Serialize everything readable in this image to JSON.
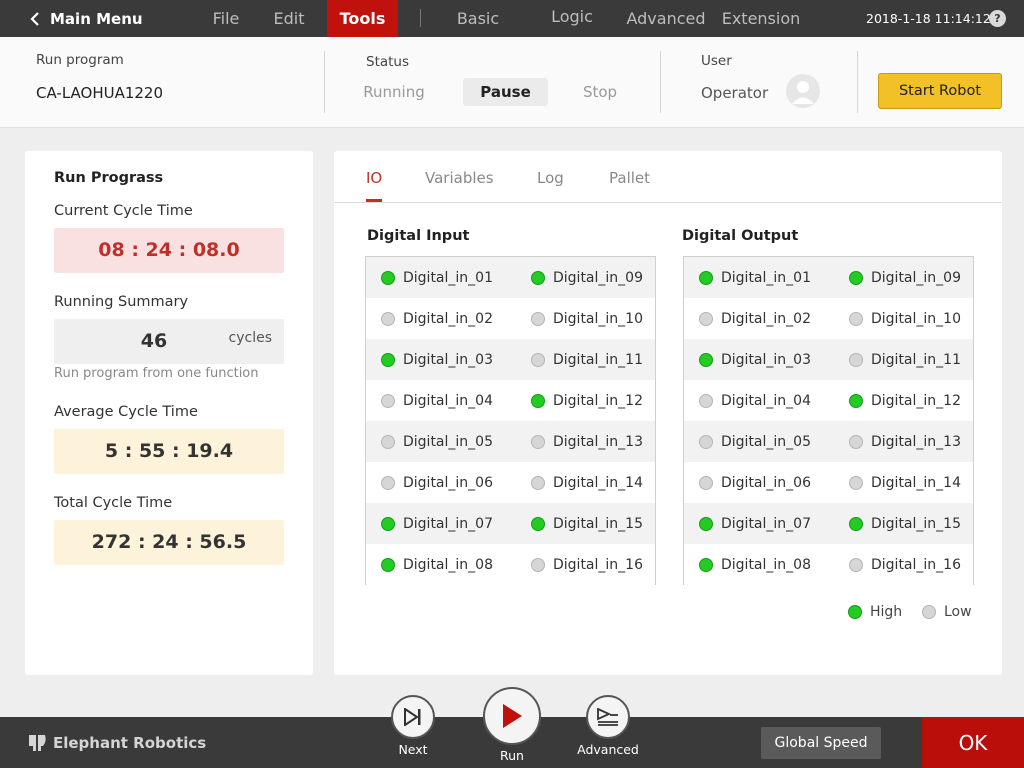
{
  "topbar": {
    "back_label": "Main Menu",
    "menu": [
      {
        "label": "File"
      },
      {
        "label": "Edit"
      },
      {
        "label": "Tools",
        "active": true
      },
      {
        "label": "Basic"
      },
      {
        "label": "Logic"
      },
      {
        "label": "Advanced"
      },
      {
        "label": "Extension"
      }
    ],
    "datetime": "2018-1-18 11:14:12",
    "help_label": "?"
  },
  "header": {
    "run_program_label": "Run program",
    "run_program_value": "CA-LAOHUA1220",
    "status_label": "Status",
    "status_options": [
      "Running",
      "Pause",
      "Stop"
    ],
    "status_active": "Pause",
    "user_label": "User",
    "user_value": "Operator",
    "start_button": "Start Robot"
  },
  "progress": {
    "title": "Run Prograss",
    "current_cycle_label": "Current Cycle Time",
    "current_cycle_value": "08 : 24 : 08.0",
    "running_summary_label": "Running Summary",
    "cycles_count": "46",
    "cycles_unit": "cycles",
    "note": "Run program from one function",
    "average_cycle_label": "Average Cycle Time",
    "average_cycle_value": "5 : 55 : 19.4",
    "total_cycle_label": "Total Cycle Time",
    "total_cycle_value": "272 : 24 : 56.5"
  },
  "tabs": [
    "IO",
    "Variables",
    "Log",
    "Pallet"
  ],
  "active_tab": "IO",
  "io": {
    "input_title": "Digital Input",
    "output_title": "Digital Output",
    "inputs": [
      {
        "name": "Digital_in_01",
        "high": true
      },
      {
        "name": "Digital_in_02",
        "high": false
      },
      {
        "name": "Digital_in_03",
        "high": true
      },
      {
        "name": "Digital_in_04",
        "high": false
      },
      {
        "name": "Digital_in_05",
        "high": false
      },
      {
        "name": "Digital_in_06",
        "high": false
      },
      {
        "name": "Digital_in_07",
        "high": true
      },
      {
        "name": "Digital_in_08",
        "high": true
      },
      {
        "name": "Digital_in_09",
        "high": true
      },
      {
        "name": "Digital_in_10",
        "high": false
      },
      {
        "name": "Digital_in_11",
        "high": false
      },
      {
        "name": "Digital_in_12",
        "high": true
      },
      {
        "name": "Digital_in_13",
        "high": false
      },
      {
        "name": "Digital_in_14",
        "high": false
      },
      {
        "name": "Digital_in_15",
        "high": true
      },
      {
        "name": "Digital_in_16",
        "high": false
      }
    ],
    "outputs": [
      {
        "name": "Digital_in_01",
        "high": true
      },
      {
        "name": "Digital_in_02",
        "high": false
      },
      {
        "name": "Digital_in_03",
        "high": true
      },
      {
        "name": "Digital_in_04",
        "high": false
      },
      {
        "name": "Digital_in_05",
        "high": false
      },
      {
        "name": "Digital_in_06",
        "high": false
      },
      {
        "name": "Digital_in_07",
        "high": true
      },
      {
        "name": "Digital_in_08",
        "high": true
      },
      {
        "name": "Digital_in_09",
        "high": true
      },
      {
        "name": "Digital_in_10",
        "high": false
      },
      {
        "name": "Digital_in_11",
        "high": false
      },
      {
        "name": "Digital_in_12",
        "high": true
      },
      {
        "name": "Digital_in_13",
        "high": false
      },
      {
        "name": "Digital_in_14",
        "high": false
      },
      {
        "name": "Digital_in_15",
        "high": true
      },
      {
        "name": "Digital_in_16",
        "high": false
      }
    ],
    "legend_high": "High",
    "legend_low": "Low"
  },
  "bottombar": {
    "brand": "Elephant Robotics",
    "next_label": "Next",
    "run_label": "Run",
    "advanced_label": "Advanced",
    "global_speed_label": "Global Speed",
    "ok_label": "OK"
  },
  "colors": {
    "accent_red": "#c0110d",
    "led_high": "#22cc22",
    "led_low": "#d6d6d6",
    "start_yellow": "#f2c027"
  },
  "icons": {
    "back": "chevron-left-icon",
    "next": "skip-next-icon",
    "run": "play-icon",
    "advanced": "advanced-play-icon",
    "user": "user-avatar-icon",
    "brand": "elephant-logo-icon"
  }
}
